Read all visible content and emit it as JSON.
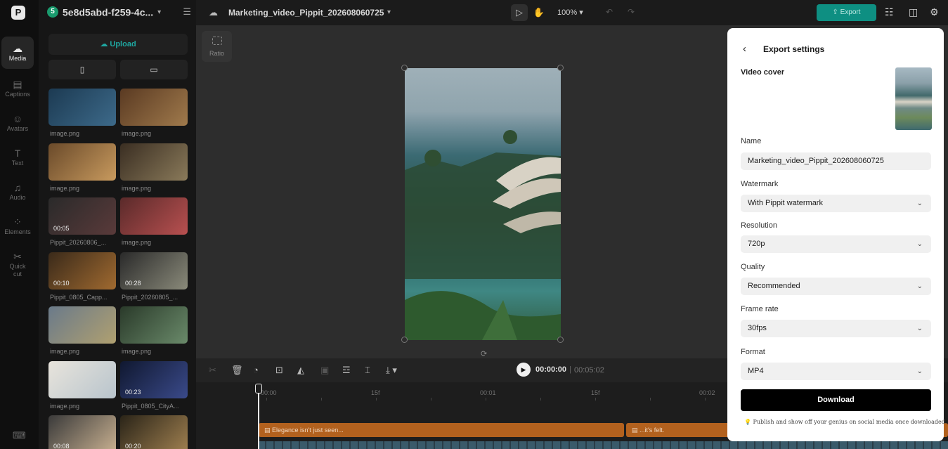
{
  "rail": {
    "items": [
      {
        "label": "Media",
        "icon": "cloud-upload-icon"
      },
      {
        "label": "Captions",
        "icon": "captions-icon"
      },
      {
        "label": "Avatars",
        "icon": "avatar-icon"
      },
      {
        "label": "Text",
        "icon": "text-icon"
      },
      {
        "label": "Audio",
        "icon": "music-note-icon"
      },
      {
        "label": "Elements",
        "icon": "elements-icon"
      },
      {
        "label": "Quick",
        "label2": "cut",
        "icon": "quick-cut-icon"
      }
    ],
    "active": "Media"
  },
  "media": {
    "project_badge": "5",
    "project_name": "5e8d5abd-f259-4c...",
    "upload_label": "Upload",
    "items": [
      {
        "label": "image.png",
        "duration": "",
        "colors": [
          "#1c3a52",
          "#3d6a8a"
        ]
      },
      {
        "label": "image.png",
        "duration": "",
        "colors": [
          "#5a3a22",
          "#a07a4c"
        ]
      },
      {
        "label": "image.png",
        "duration": "",
        "colors": [
          "#6a4a2a",
          "#c89a5e"
        ]
      },
      {
        "label": "image.png",
        "duration": "",
        "colors": [
          "#3a2e22",
          "#8a7a5a"
        ]
      },
      {
        "label": "Pippit_20260806_...",
        "duration": "00:05",
        "colors": [
          "#2a2a2a",
          "#5a3a3a"
        ]
      },
      {
        "label": "image.png",
        "duration": "",
        "colors": [
          "#5a2a2a",
          "#b85050"
        ]
      },
      {
        "label": "Pippit_0805_Capp...",
        "duration": "00:10",
        "colors": [
          "#3a2a1a",
          "#a06a30"
        ]
      },
      {
        "label": "Pippit_20260805_...",
        "duration": "00:28",
        "colors": [
          "#2a2a2a",
          "#8a8a7a"
        ]
      },
      {
        "label": "image.png",
        "duration": "",
        "colors": [
          "#6a7a8a",
          "#b0a070"
        ]
      },
      {
        "label": "image.png",
        "duration": "",
        "colors": [
          "#2a3a2a",
          "#6a8a6a"
        ]
      },
      {
        "label": "image.png",
        "duration": "",
        "colors": [
          "#e8e4dc",
          "#b8c4cc"
        ]
      },
      {
        "label": "Pippit_0805_CityA...",
        "duration": "00:23",
        "colors": [
          "#101830",
          "#3a4a8a"
        ]
      },
      {
        "label": "",
        "duration": "00:08",
        "colors": [
          "#3a3a3a",
          "#c8b090"
        ]
      },
      {
        "label": "",
        "duration": "00:20",
        "colors": [
          "#2a2418",
          "#a08050"
        ]
      }
    ]
  },
  "topbar": {
    "title": "Marketing_video_Pippit_202608060725",
    "zoom": "100%",
    "export_label": "Export"
  },
  "canvas": {
    "ratio_label": "Ratio"
  },
  "timeline": {
    "current_time": "00:00:00",
    "separator": "|",
    "total_time": "00:05:02",
    "ruler": [
      "00:00",
      "15f",
      "00:01",
      "15f",
      "00:02"
    ],
    "captions": [
      {
        "text": "Elegance isn't just seen..."
      },
      {
        "text": "...it's felt."
      }
    ]
  },
  "export_panel": {
    "title": "Export settings",
    "video_cover_label": "Video cover",
    "name_label": "Name",
    "name_value": "Marketing_video_Pippit_202608060725",
    "watermark_label": "Watermark",
    "watermark_value": "With Pippit watermark",
    "resolution_label": "Resolution",
    "resolution_value": "720p",
    "quality_label": "Quality",
    "quality_value": "Recommended",
    "framerate_label": "Frame rate",
    "framerate_value": "30fps",
    "format_label": "Format",
    "format_value": "MP4",
    "download_label": "Download",
    "note": "Publish and show off your genius on social media once downloaded."
  }
}
